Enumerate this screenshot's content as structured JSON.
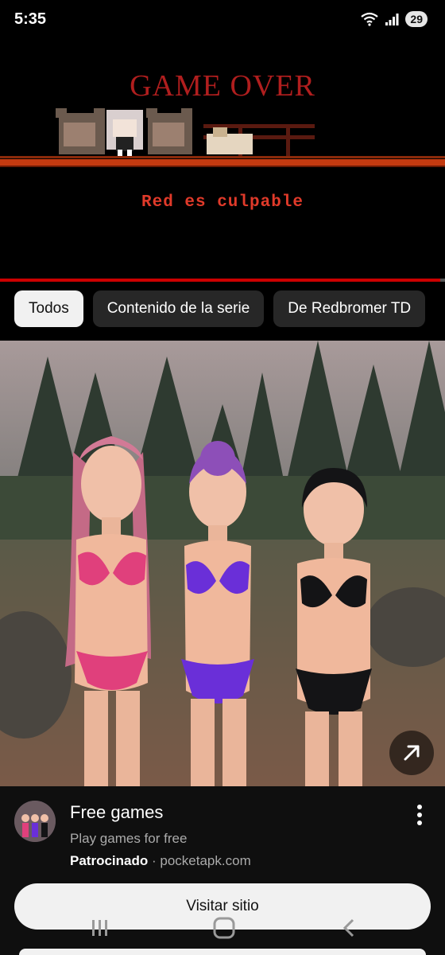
{
  "status_bar": {
    "time": "5:35",
    "battery": "29"
  },
  "video": {
    "title_text": "GAME OVER",
    "caption": "Red es culpable",
    "progress": 0.99
  },
  "chips": [
    {
      "label": "Todos",
      "active": true
    },
    {
      "label": "Contenido de la serie",
      "active": false
    },
    {
      "label": "De Redbromer TD",
      "active": false
    }
  ],
  "ad": {
    "title": "Free games",
    "description": "Play games for free",
    "sponsored_label": "Patrocinado",
    "separator": "·",
    "domain": "pocketapk.com",
    "cta_label": "Visitar sitio",
    "open_icon": "arrow-up-right-icon",
    "menu_icon": "more-vert-icon"
  },
  "colors": {
    "accent_red": "#cc0000",
    "game_over_red": "#b01e1e",
    "chip_active_bg": "#f1f1f1",
    "chip_bg": "#272727"
  }
}
